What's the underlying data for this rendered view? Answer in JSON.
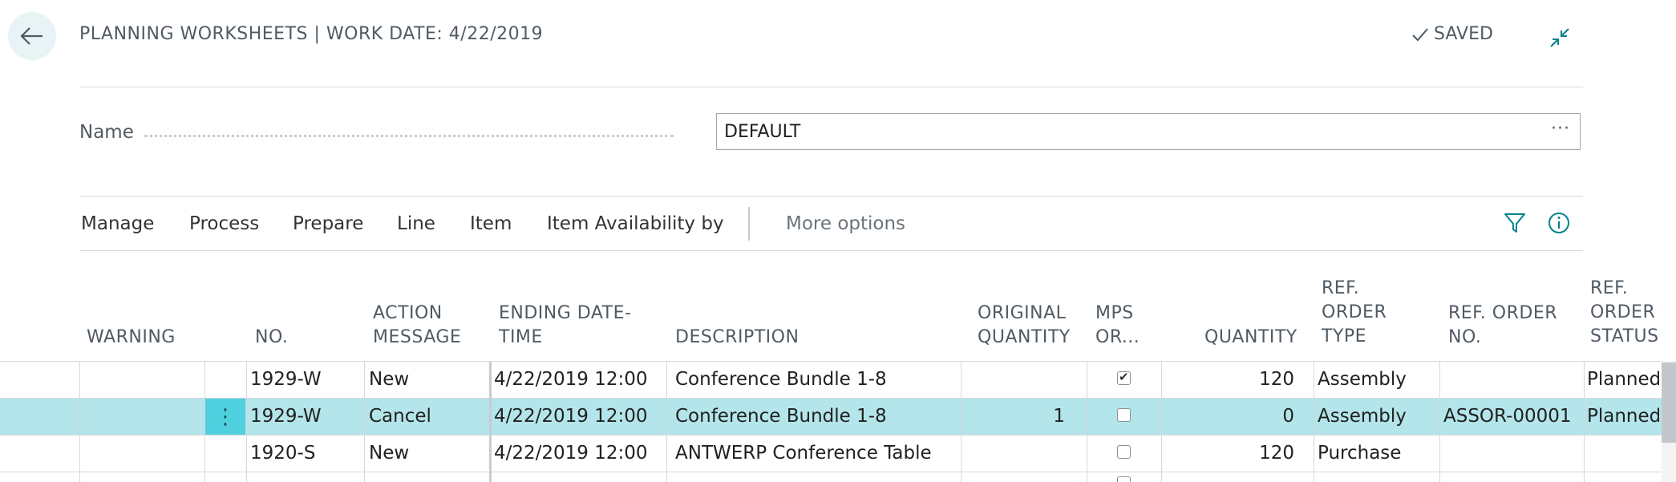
{
  "header": {
    "title": "PLANNING WORKSHEETS | WORK DATE: 4/22/2019",
    "saved_label": "SAVED",
    "accent_color": "#00838f"
  },
  "name_field": {
    "label": "Name",
    "value": "DEFAULT",
    "more_label": "···"
  },
  "action_bar": {
    "items": [
      "Manage",
      "Process",
      "Prepare",
      "Line",
      "Item",
      "Item Availability by"
    ],
    "more_options": "More options"
  },
  "table": {
    "columns": {
      "warning": "WARNING",
      "no": "NO.",
      "action_message": [
        "ACTION",
        "MESSAGE"
      ],
      "ending_date_time": [
        "ENDING DATE-",
        "TIME"
      ],
      "description": "DESCRIPTION",
      "original_quantity": [
        "ORIGINAL",
        "QUANTITY"
      ],
      "mps_order": [
        "MPS",
        "OR..."
      ],
      "quantity": "QUANTITY",
      "ref_order_type": [
        "REF.",
        "ORDER",
        "TYPE"
      ],
      "ref_order_no": [
        "REF. ORDER",
        "NO."
      ],
      "ref_order_status": [
        "REF.",
        "ORDER",
        "STATUS"
      ]
    },
    "rows": [
      {
        "no": "1929-W",
        "action": "New",
        "ending": "4/22/2019 12:00 ...",
        "description": "Conference Bundle 1-8",
        "original_qty": "",
        "mps": true,
        "quantity": "120",
        "ref_type": "Assembly",
        "ref_no": "",
        "ref_status": "Planned",
        "selected": false
      },
      {
        "no": "1929-W",
        "action": "Cancel",
        "ending": "4/22/2019 12:00 ...",
        "description": "Conference Bundle 1-8",
        "original_qty": "1",
        "mps": false,
        "quantity": "0",
        "ref_type": "Assembly",
        "ref_no": "ASSOR-00001",
        "ref_status": "Planned",
        "selected": true
      },
      {
        "no": "1920-S",
        "action": "New",
        "ending": "4/22/2019 12:00 ...",
        "description": "ANTWERP Conference Table",
        "original_qty": "",
        "mps": false,
        "quantity": "120",
        "ref_type": "Purchase",
        "ref_no": "",
        "ref_status": "",
        "selected": false
      }
    ],
    "row_menu_glyph": "⋮",
    "selected_row_color": "#b3e5ea"
  }
}
